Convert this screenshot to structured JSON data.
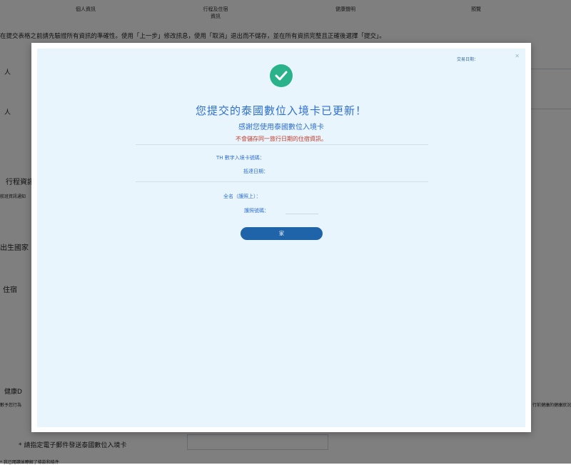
{
  "steps": [
    "個人資訊",
    "行程及住宿",
    "資訊",
    "健康聲明",
    "預覽"
  ],
  "instruction": "在提交表格之前請先驗證所有資訊的準確性。使用「上一步」修改訊息，使用「取消」退出而不儲存，並在所有資訊完整且正確後選擇「提交」。",
  "background_labels": {
    "person1": "人",
    "person2": "人",
    "trip_info": "行程資訊",
    "trip_note": "航班資訊通知",
    "birth_country": "出生國家",
    "lodging": "住宿",
    "health": "健康D",
    "travel": "數予您行為",
    "health_side": "行前健康的健康狀況",
    "email_note": "* 請指定電子郵件發送泰國數位入境卡",
    "footer_note": "* 我已閱讀並瞭解了條款和條件"
  },
  "modal": {
    "date_label": "交易日期：",
    "title": "您提交的泰國數位入境卡已更新！",
    "subtitle": "感謝您使用泰國數位入境卡",
    "warning": "不會儲存同一旅行日期的住宿資訊。",
    "card_no_label": "TH 數字入境卡號碼：",
    "arrival_date_label": "抵達日期：",
    "full_name_label": "全名（護照上）：",
    "passport_label": "護照號碼：",
    "home_button": "家"
  },
  "colors": {
    "accent": "#2e6fd1",
    "button": "#1f63a8",
    "success": "#2ab38b",
    "warning": "#c0392b",
    "modal_panel": "#e9f5fc"
  },
  "icons": {
    "success": "check-circle-icon",
    "close": "close-icon"
  }
}
